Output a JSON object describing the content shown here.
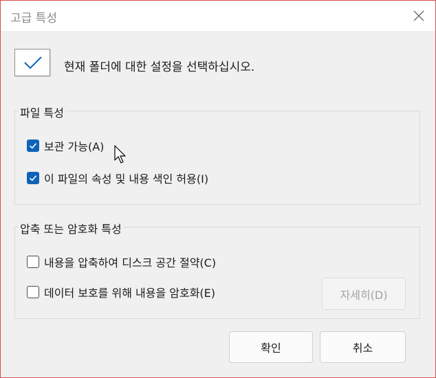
{
  "window": {
    "title": "고급 특성"
  },
  "header": {
    "text": "현재 폴더에 대한 설정을 선택하십시오."
  },
  "file_attributes": {
    "label": "파일 특성",
    "archive": {
      "label": "보관 가능(A)",
      "checked": true
    },
    "index": {
      "label": "이 파일의 속성 및 내용 색인 허용(I)",
      "checked": true
    }
  },
  "compress_encrypt": {
    "label": "압축 또는 암호화 특성",
    "compress": {
      "label": "내용을 압축하여 디스크 공간 절약(C)",
      "checked": false
    },
    "encrypt": {
      "label": "데이터 보호를 위해 내용을 암호화(E)",
      "checked": false
    },
    "details_button": "자세히(D)"
  },
  "buttons": {
    "ok": "확인",
    "cancel": "취소"
  },
  "colors": {
    "accent": "#0e63b8",
    "window_border": "#d24a4a"
  }
}
